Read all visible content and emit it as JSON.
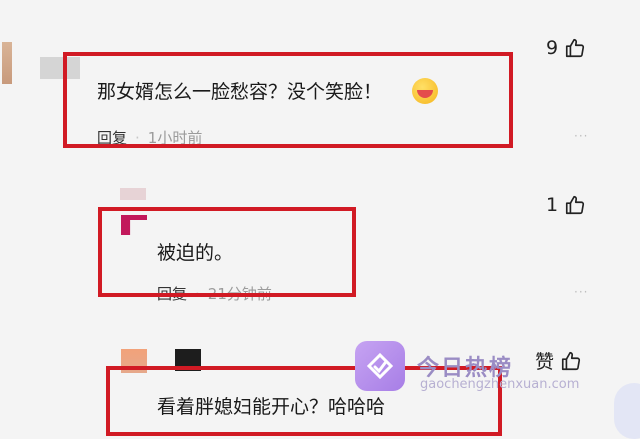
{
  "comments": [
    {
      "text": "那女婿怎么一脸愁容？没个笑脸！",
      "reply_label": "回复",
      "time": "1小时前",
      "likes": "9",
      "more": "···"
    },
    {
      "text": "被迫的。",
      "reply_label": "回复",
      "time": "21分钟前",
      "likes": "1",
      "more": "···"
    },
    {
      "text": "看着胖媳妇能开心？哈哈哈",
      "likes": "赞"
    }
  ],
  "watermark": {
    "title": "今日热榜",
    "url": "gaochengzhenxuan.com"
  },
  "colors": {
    "highlight": "#d11a24",
    "background": "#f4f4f4"
  }
}
